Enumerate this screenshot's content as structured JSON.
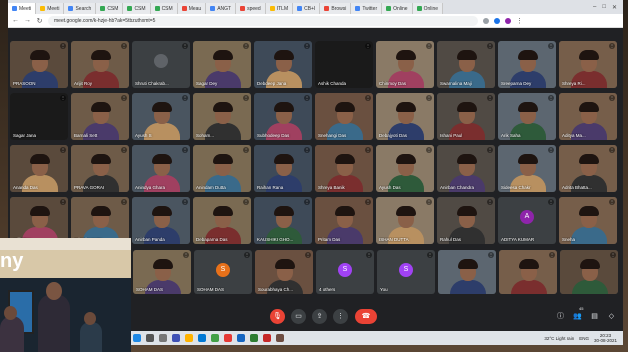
{
  "browser": {
    "tabs": [
      {
        "label": "Meeti",
        "fav": "b"
      },
      {
        "label": "Meeti",
        "fav": "g"
      },
      {
        "label": "Search",
        "fav": "b"
      },
      {
        "label": "CSM",
        "fav": "gr"
      },
      {
        "label": "CSM",
        "fav": "gr"
      },
      {
        "label": "CSM",
        "fav": "gr"
      },
      {
        "label": "Meau",
        "fav": "r"
      },
      {
        "label": "ANGT",
        "fav": "b"
      },
      {
        "label": "speed",
        "fav": "r"
      },
      {
        "label": "ITLM",
        "fav": "g"
      },
      {
        "label": "CB+I",
        "fav": "b"
      },
      {
        "label": "Browsi",
        "fav": "r"
      },
      {
        "label": "Twitter",
        "fav": "b"
      },
      {
        "label": "Online",
        "fav": "gr"
      },
      {
        "label": "Online",
        "fav": "gr"
      }
    ],
    "url": "meet.google.com/k-hzje-hb?ak=5tbzuthxmt=5"
  },
  "participants_top": [
    {
      "name": "PRASOON"
    },
    {
      "name": "Arijit Roy"
    },
    {
      "name": "Shruti Chakrab...",
      "avatar": true,
      "initial": "",
      "color": "#5f6368"
    },
    {
      "name": "Sagar Dey"
    },
    {
      "name": "Debdeep Jana"
    },
    {
      "name": "Ashik Chanda",
      "dark": true
    },
    {
      "name": "Chinmoy Das"
    },
    {
      "name": "Swarnalina Maji"
    },
    {
      "name": "Sreeparna Dey"
    },
    {
      "name": "Shreya Ri..."
    },
    {
      "name": "Sagar Jana",
      "dark": true
    },
    {
      "name": "Barnali Sett"
    },
    {
      "name": "Ayush S"
    },
    {
      "name": "Soham..."
    },
    {
      "name": "Subhodeep Das"
    },
    {
      "name": "Snehangi Das"
    },
    {
      "name": "Debajyoti Das"
    },
    {
      "name": "Ishani Paul"
    },
    {
      "name": "Arik Saha"
    },
    {
      "name": "Aditya Ma..."
    },
    {
      "name": "Ananda Das"
    },
    {
      "name": "PRAVA GORAI"
    },
    {
      "name": "Anindya Ghara"
    },
    {
      "name": "Anindam Dutta"
    },
    {
      "name": "Raihan Rana"
    },
    {
      "name": "Shreya Banik"
    },
    {
      "name": "Ayush Das"
    },
    {
      "name": "Anirban Chandra"
    },
    {
      "name": "Sideesa Chakr"
    },
    {
      "name": "Adrita Bhatta..."
    },
    {
      "name": "Arijit Roy"
    },
    {
      "name": "Pritesha Kutty"
    },
    {
      "name": "Anirban Panda"
    },
    {
      "name": "Debaparna Das"
    },
    {
      "name": "KAUSHIKI GHO..."
    },
    {
      "name": "Pritam Das"
    },
    {
      "name": "ISHAN DUTTA"
    },
    {
      "name": "Rahul Das"
    },
    {
      "name": "ADITYA KUMAR",
      "avatar": true,
      "initial": "A",
      "color": "#8e24aa"
    },
    {
      "name": "Sneha"
    }
  ],
  "participants_bottom": [
    {
      "name": "... Aditi"
    },
    {
      "name": "SOURAV JHA",
      "avatar": true,
      "initial": "S",
      "color": "#e8711a"
    },
    {
      "name": "Aparup Sen"
    },
    {
      "name": "SOHAM DAS",
      "avatar": true,
      "initial": "S",
      "color": "#a142f4"
    },
    {
      "name": "SOHAM DAS",
      "avatar": true,
      "initial": "S",
      "color": "#a142f4"
    },
    {
      "name": "Sourabhaya Ch..."
    },
    {
      "name": "4 others"
    },
    {
      "name": "You"
    }
  ],
  "controls": {
    "mic_icon": "mic-off-icon",
    "cam_icon": "camera-icon",
    "present_icon": "present-icon",
    "more_icon": "more-icon",
    "hangup_icon": "hangup-icon",
    "participants_count": "45"
  },
  "taskbar": {
    "weather": "32°C Light rain",
    "lang": "ENG",
    "time": "20:23",
    "date": "30-08-2021"
  },
  "photo": {
    "wall_text": "ny"
  }
}
